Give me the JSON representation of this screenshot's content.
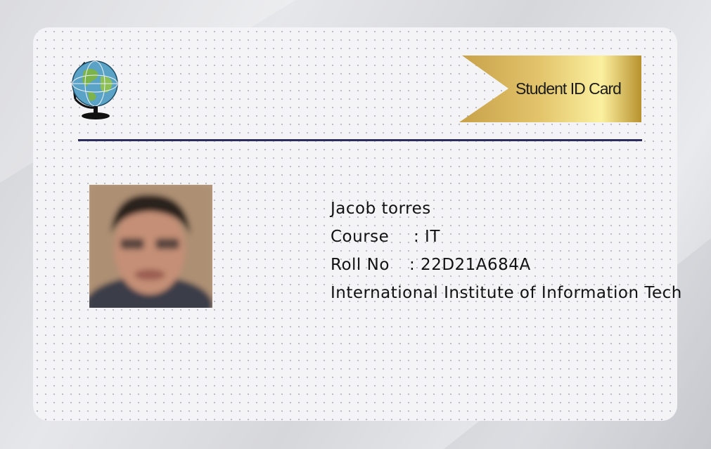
{
  "card": {
    "banner_label": "Student ID Card",
    "student": {
      "name": "Jacob torres",
      "course_label": "Course",
      "course_value": ": IT",
      "roll_label": "Roll No",
      "roll_value": ": 22D21A684A",
      "institute": "International Institute of Information Tech"
    }
  },
  "colors": {
    "divider": "#2c2c5e",
    "banner_gold_light": "#fbf0a0",
    "banner_gold_dark": "#b8912e",
    "card_background": "#f4f4f7"
  },
  "icons": [
    "globe-icon"
  ]
}
